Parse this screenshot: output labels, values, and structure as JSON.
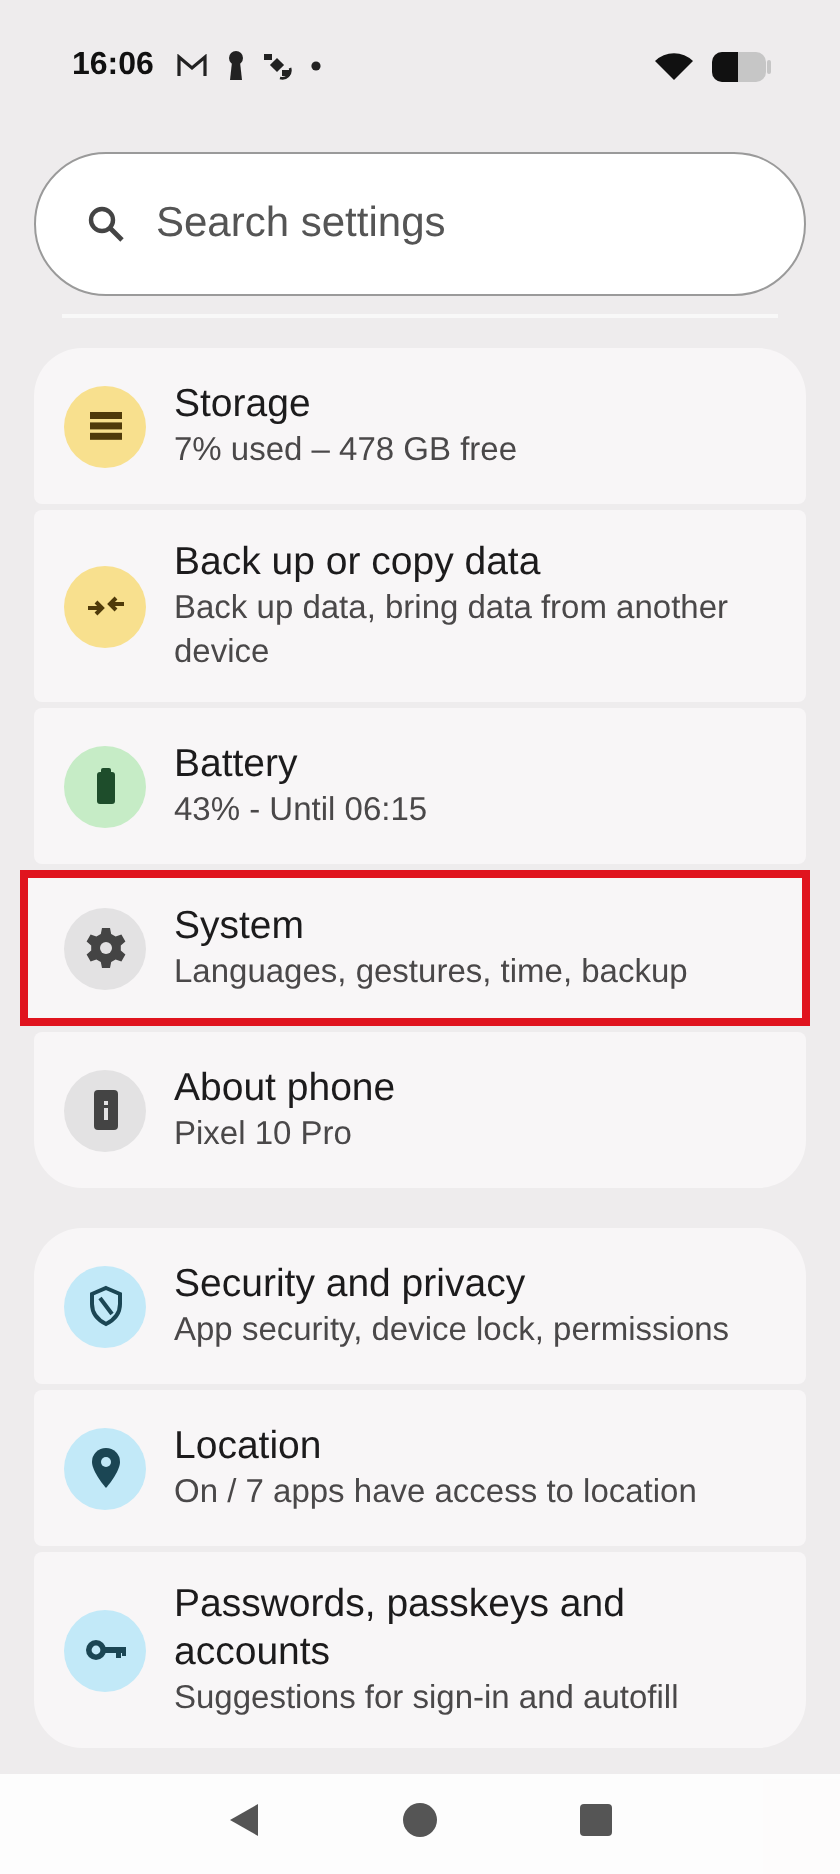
{
  "status_bar": {
    "time": "16:06"
  },
  "search": {
    "placeholder": "Search settings"
  },
  "groups": [
    {
      "items": [
        {
          "title": "Storage",
          "subtitle": "7% used – 478 GB free",
          "color": "#f8e08e",
          "highlighted": false
        },
        {
          "title": "Back up or copy data",
          "subtitle": "Back up data, bring data from another device",
          "color": "#f8e08e",
          "highlighted": false
        },
        {
          "title": "Battery",
          "subtitle": "43% - Until 06:15",
          "color": "#c6ecc6",
          "highlighted": false
        },
        {
          "title": "System",
          "subtitle": "Languages, gestures, time, backup",
          "color": "#e3e2e3",
          "highlighted": true
        },
        {
          "title": "About phone",
          "subtitle": "Pixel 10 Pro",
          "color": "#e3e2e3",
          "highlighted": false
        }
      ]
    },
    {
      "items": [
        {
          "title": "Security and privacy",
          "subtitle": "App security, device lock, permissions",
          "color": "#c2e9f8",
          "highlighted": false
        },
        {
          "title": "Location",
          "subtitle": "On / 7 apps have access to location",
          "color": "#c2e9f8",
          "highlighted": false
        },
        {
          "title": "Passwords, passkeys and accounts",
          "subtitle": "Suggestions for sign-in and autofill",
          "color": "#c2e9f8",
          "highlighted": false
        }
      ]
    }
  ]
}
